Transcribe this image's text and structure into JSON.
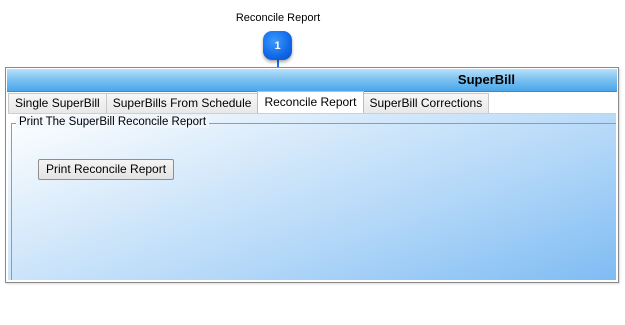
{
  "callout": {
    "label": "Reconcile Report",
    "number": "1"
  },
  "window": {
    "title": "SuperBill"
  },
  "tabs": [
    {
      "label": "Single SuperBill"
    },
    {
      "label": "SuperBills From Schedule"
    },
    {
      "label": "Reconcile Report"
    },
    {
      "label": "SuperBill Corrections"
    }
  ],
  "active_tab": "Reconcile Report",
  "panel": {
    "group_title": "Print The SuperBill Reconcile Report",
    "print_button_label": "Print Reconcile Report"
  },
  "colors": {
    "callout_badge": "#1168e8",
    "titlebar": "#7fc3f2",
    "panel_gradient_end": "#7fbcf3"
  }
}
